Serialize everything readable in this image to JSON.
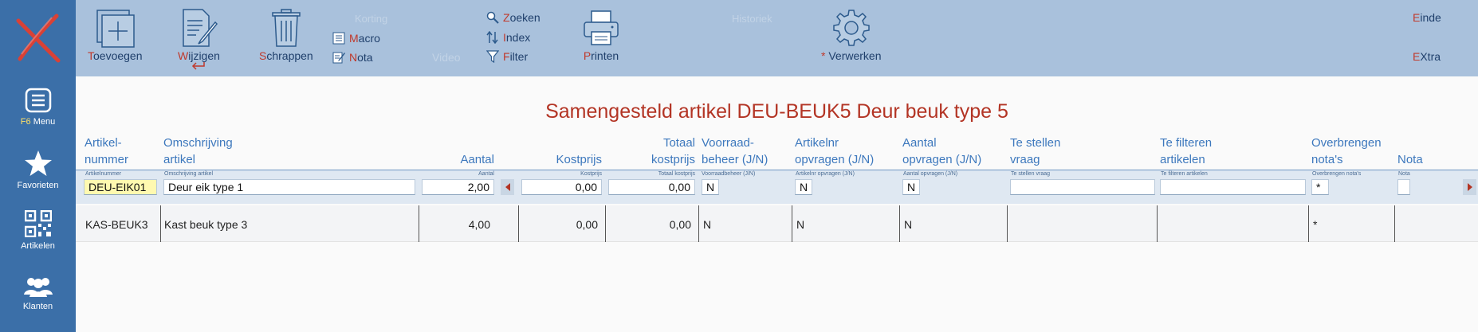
{
  "sidebar": {
    "menu": {
      "key": "F6",
      "label": "Menu"
    },
    "items": [
      {
        "label": "Favorieten"
      },
      {
        "label": "Artikelen"
      },
      {
        "label": "Klanten"
      }
    ]
  },
  "toolbar": {
    "toevoegen": {
      "hk": "T",
      "rest": "oevoegen"
    },
    "wijzigen": {
      "hk": "W",
      "rest": "ijzigen"
    },
    "schrappen": {
      "hk": "S",
      "rest": "chrappen"
    },
    "korting": "Korting",
    "macro": {
      "hk": "M",
      "rest": "acro"
    },
    "nota": {
      "hk": "N",
      "rest": "ota"
    },
    "video": "Video",
    "zoeken": {
      "hk": "Z",
      "rest": "oeken"
    },
    "index": {
      "hk": "I",
      "rest": "ndex"
    },
    "filter": {
      "hk": "F",
      "rest": "ilter"
    },
    "printen": {
      "hk": "P",
      "rest": "rinten"
    },
    "historiek": "Historiek",
    "verwerken": {
      "hk": "*",
      "rest": " Verwerken"
    },
    "einde": {
      "hk": "E",
      "rest": "inde"
    },
    "extra": {
      "hk": "E",
      "rest": "Xtra"
    }
  },
  "page": {
    "title": "Samengesteld artikel DEU-BEUK5 Deur beuk type 5"
  },
  "columns": [
    {
      "label": "Artikel-\nnummer",
      "mini": "Artikelnummer"
    },
    {
      "label": "Omschrijving\nartikel",
      "mini": "Omschrijving artikel"
    },
    {
      "label": "Aantal",
      "mini": "Aantal"
    },
    {
      "label": "Kostprijs",
      "mini": "Kostprijs"
    },
    {
      "label": "Totaal\nkostprijs",
      "mini": "Totaal kostprijs"
    },
    {
      "label": "Voorraad-\nbeheer (J/N)",
      "mini": "Voorraadbeheer (J/N)"
    },
    {
      "label": "Artikelnr\nopvragen (J/N)",
      "mini": "Artikelnr opvragen (J/N)"
    },
    {
      "label": "Aantal\nopvragen (J/N)",
      "mini": "Aantal opvragen (J/N)"
    },
    {
      "label": "Te stellen\nvraag",
      "mini": "Te stellen vraag"
    },
    {
      "label": "Te filteren\nartikelen",
      "mini": "Te filteren artikelen"
    },
    {
      "label": "Overbrengen\nnota's",
      "mini": "Overbrengen nota's"
    },
    {
      "label": "Nota",
      "mini": "Nota"
    }
  ],
  "edit_row": {
    "artikelnummer": "DEU-EIK01",
    "omschrijving": "Deur eik type 1",
    "aantal": "2,00",
    "kostprijs": "0,00",
    "totaal": "0,00",
    "voorraadbeheer": "N",
    "artikelnr_opvragen": "N",
    "aantal_opvragen": "N",
    "te_stellen_vraag": "",
    "te_filteren": "",
    "overbrengen": "*",
    "nota": ""
  },
  "rows": [
    {
      "artikelnummer": "KAS-BEUK3",
      "omschrijving": "Kast beuk type 3",
      "aantal": "4,00",
      "kostprijs": "0,00",
      "totaal": "0,00",
      "voorraadbeheer": "N",
      "artikelnr_opvragen": "N",
      "aantal_opvragen": "N",
      "overbrengen": "*"
    }
  ]
}
